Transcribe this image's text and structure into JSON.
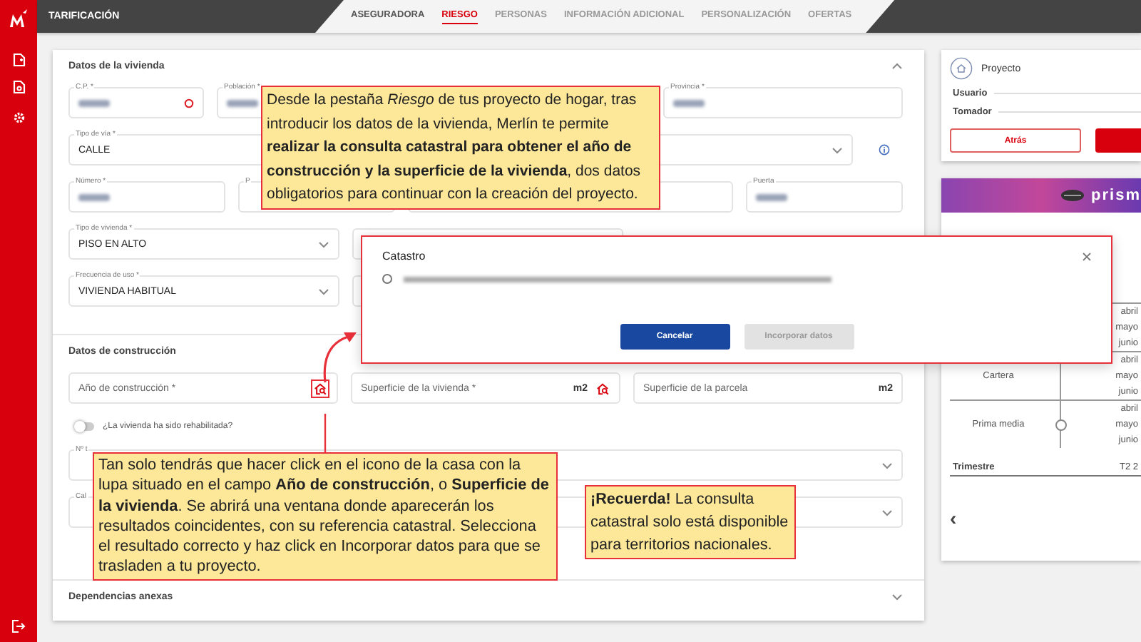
{
  "header": {
    "title": "TARIFICACIÓN",
    "tabs": [
      {
        "label": "ASEGURADORA",
        "selected": false,
        "disabled": false
      },
      {
        "label": "RIESGO",
        "selected": true,
        "disabled": false
      },
      {
        "label": "PERSONAS",
        "selected": false,
        "disabled": true
      },
      {
        "label": "INFORMACIÓN ADICIONAL",
        "selected": false,
        "disabled": true
      },
      {
        "label": "PERSONALIZACIÓN",
        "selected": false,
        "disabled": true
      },
      {
        "label": "OFERTAS",
        "selected": false,
        "disabled": true
      }
    ]
  },
  "sections": [
    {
      "title": "Datos de la vivienda",
      "expanded": true,
      "rows": [
        [
          {
            "kind": "refresh",
            "label": "C.P. *",
            "obscured": true
          },
          {
            "kind": "text",
            "label": "Población *",
            "obscured": true
          },
          {
            "kind": "text",
            "label": "Provincia *",
            "obscured": true
          }
        ],
        [
          {
            "kind": "select",
            "label": "Tipo de vía *",
            "value": "CALLE",
            "info": true
          }
        ],
        [
          {
            "kind": "text",
            "label": "Número *",
            "obscured": true
          },
          {
            "kind": "text",
            "label": "P"
          },
          {
            "kind": "text"
          },
          {
            "kind": "text",
            "label": "Puerta",
            "obscured": true
          }
        ],
        [
          {
            "kind": "select",
            "label": "Tipo de vivienda *",
            "value": "PISO EN ALTO"
          },
          {
            "kind": "text"
          }
        ],
        [
          {
            "kind": "select",
            "label": "Frecuencia de uso *",
            "value": "VIVIENDA HABITUAL"
          },
          {
            "kind": "text"
          }
        ]
      ]
    },
    {
      "title": "Datos de construcción",
      "expanded": true,
      "rows": [
        [
          {
            "kind": "lookup",
            "placeholder": "Año de construcción *",
            "highlighted": true
          },
          {
            "kind": "lookup",
            "placeholder": "Superficie de la vivienda *",
            "unit": "m2",
            "highlighted": false
          },
          {
            "kind": "text",
            "placeholder": "Superficie de la parcela",
            "unit": "m2"
          }
        ],
        [
          {
            "kind": "toggle",
            "label": "¿La vivienda ha sido rehabilitada?",
            "on": false
          }
        ],
        [
          {
            "kind": "select",
            "label": "Nº t"
          }
        ],
        [
          {
            "kind": "select",
            "label": "Cal"
          }
        ]
      ]
    },
    {
      "title": "Dependencias anexas",
      "expanded": false
    }
  ],
  "dialog": {
    "title": "Catastro",
    "options": [
      {
        "selected": false
      }
    ],
    "buttons": [
      {
        "label": "Cancelar",
        "disabled": false
      },
      {
        "label": "Incorporar datos",
        "disabled": true
      }
    ]
  },
  "callouts": [
    {
      "text": "Desde la pestaña *Riesgo* de tus proyecto de hogar, tras introducir los datos de la vivienda, Merlín te permite **realizar la consulta catastral para obtener el año de construcción y la superficie de la vivienda**, dos datos obligatorios para continuar con la creación del proyecto."
    },
    {
      "text": "Tan solo tendrás que hacer click en el icono de la casa con la lupa situado en el campo **Año de construcción**, o **Superficie de la vivienda**. Se abrirá una ventana donde aparecerán los resultados coincidentes, con su referencia catastral. Selecciona el resultado correcto y haz click en Incorporar datos para que se trasladen a tu proyecto."
    },
    {
      "text": "**¡Recuerda!** La consulta catastral solo está disponible para territorios nacionales."
    }
  ],
  "project": {
    "title": "Proyecto",
    "fields": [
      {
        "label": "Usuario"
      },
      {
        "label": "Tomador"
      }
    ],
    "buttons": [
      {
        "kind": "outline",
        "label": "Atrás"
      },
      {
        "kind": "primary"
      }
    ],
    "banner": {
      "text": "prism"
    },
    "table": {
      "rows": [
        {
          "months": [
            "abril",
            "mayo",
            "junio"
          ]
        },
        {
          "label": "Cartera",
          "months": [
            "abril",
            "mayo",
            "junio"
          ]
        },
        {
          "label": "Prima media",
          "months": [
            "abril",
            "mayo",
            "junio"
          ],
          "point": true
        }
      ],
      "footer": {
        "label": "Trimestre",
        "value": "T2 2"
      }
    },
    "pager": "‹"
  }
}
